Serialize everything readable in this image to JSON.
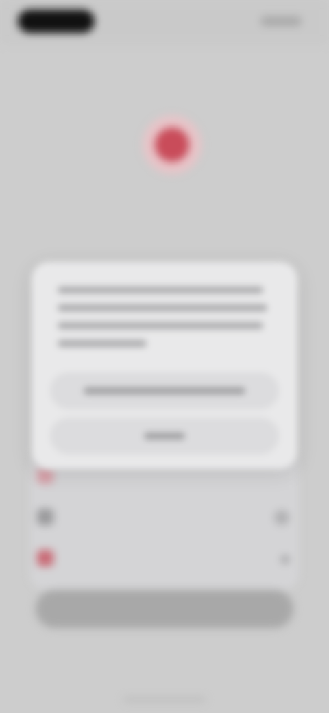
{
  "status_bar": {
    "time": "",
    "indicators": ""
  },
  "header": {
    "title": ""
  },
  "record_button": {
    "icon": "record-icon",
    "accent": "#c94c5a"
  },
  "section": {
    "title": ""
  },
  "list": {
    "items": [
      {
        "label": "",
        "icon": "item-icon",
        "icon_color": "#d6a0a8"
      },
      {
        "label": "",
        "icon": "item-icon",
        "icon_color": "#9a9a9c"
      },
      {
        "label": "",
        "icon": "item-icon",
        "icon_color": "#c96b76"
      }
    ]
  },
  "primary_action": {
    "label": ""
  },
  "footer": {
    "link": ""
  },
  "dialog": {
    "message": "",
    "confirm_label": "",
    "cancel_label": ""
  }
}
